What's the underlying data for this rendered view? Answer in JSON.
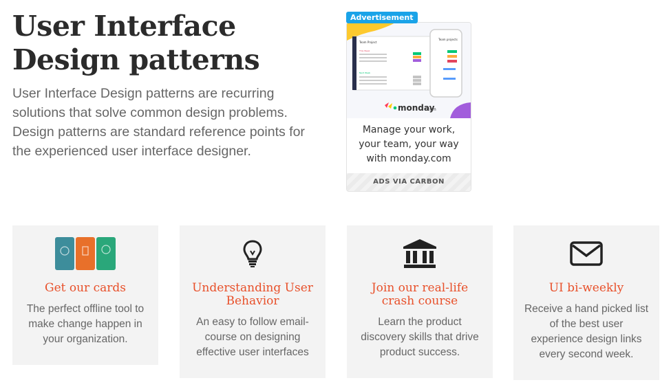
{
  "hero": {
    "title": "User Interface Design patterns",
    "description": "User Interface Design patterns are recurring solutions that solve common design problems. Design patterns are standard reference points for the experienced user interface designer."
  },
  "ad": {
    "badge": "Advertisement",
    "brand": "monday",
    "brand_suffix": ".com",
    "text": "Manage your work, your team, your way with monday.com",
    "footer": "ADS VIA CARBON",
    "mock_left_title": "Team Project",
    "mock_right_title": "Team projects"
  },
  "cards": [
    {
      "icon": "cards-icon",
      "title": "Get our cards",
      "description": "The perfect offline tool to make change happen in your organization."
    },
    {
      "icon": "lightbulb-icon",
      "title": "Understanding User Behavior",
      "description": "An easy to follow email-course on designing effective user interfaces"
    },
    {
      "icon": "institution-icon",
      "title": "Join our real-life crash course",
      "description": "Learn the product discovery skills that drive product success."
    },
    {
      "icon": "envelope-icon",
      "title": "UI bi-weekly",
      "description": "Receive a hand picked list of the best user experience design links every second week."
    }
  ],
  "colors": {
    "accent": "#e8502a",
    "card_bg": "#f3f3f3",
    "ad_badge": "#1aa3e8"
  }
}
